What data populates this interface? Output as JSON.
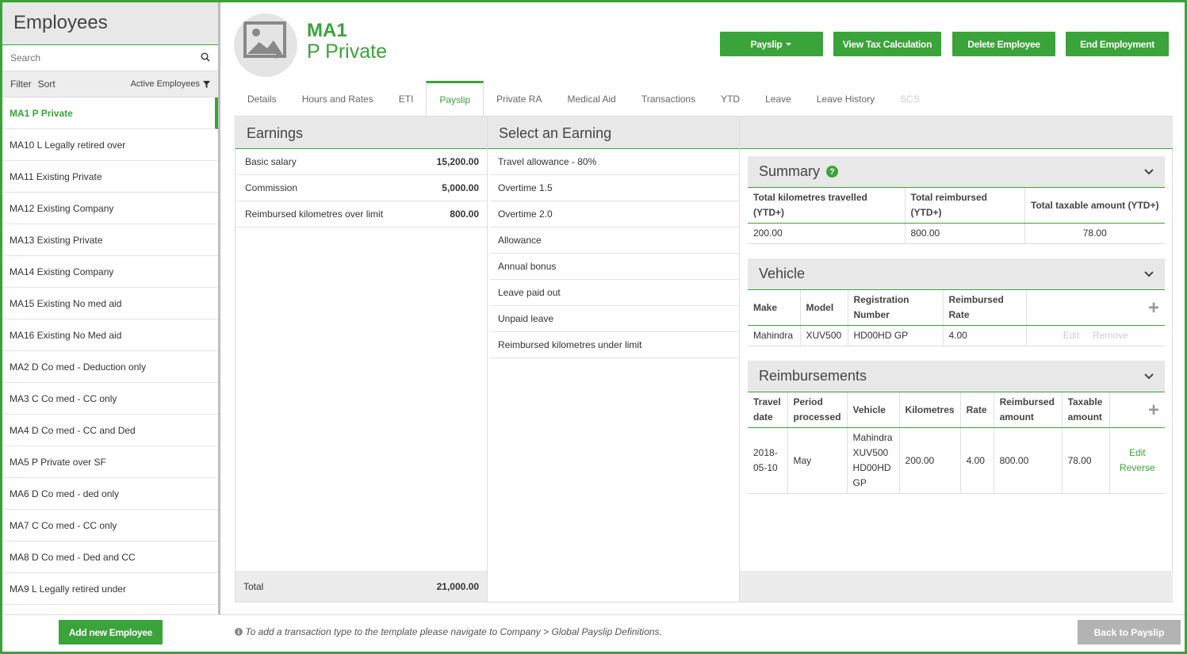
{
  "sidebar": {
    "title": "Employees",
    "search_placeholder": "Search",
    "filter_label": "Filter",
    "sort_label": "Sort",
    "active_filter": "Active Employees",
    "items": [
      {
        "label": "MA1 P Private",
        "selected": true
      },
      {
        "label": "MA10 L Legally retired over"
      },
      {
        "label": "MA11 Existing Private"
      },
      {
        "label": "MA12 Existing Company"
      },
      {
        "label": "MA13 Existing Private"
      },
      {
        "label": "MA14 Existing Company"
      },
      {
        "label": "MA15 Existing No med aid"
      },
      {
        "label": "MA16 Existing No Med aid"
      },
      {
        "label": "MA2 D Co med - Deduction only"
      },
      {
        "label": "MA3 C Co med - CC only"
      },
      {
        "label": "MA4 D Co med - CC and Ded"
      },
      {
        "label": "MA5 P Private over SF"
      },
      {
        "label": "MA6 D Co med - ded only"
      },
      {
        "label": "MA7 C Co med - CC only"
      },
      {
        "label": "MA8 D Co med - Ded and CC"
      },
      {
        "label": "MA9 L Legally retired under"
      }
    ],
    "add_button": "Add new Employee"
  },
  "header": {
    "code": "MA1",
    "name": "P Private",
    "buttons": {
      "payslip": "Payslip",
      "tax": "View Tax Calculation",
      "delete": "Delete Employee",
      "end": "End Employment"
    }
  },
  "tabs": [
    {
      "label": "Details"
    },
    {
      "label": "Hours and Rates"
    },
    {
      "label": "ETI"
    },
    {
      "label": "Payslip",
      "active": true
    },
    {
      "label": "Private RA"
    },
    {
      "label": "Medical Aid"
    },
    {
      "label": "Transactions"
    },
    {
      "label": "YTD"
    },
    {
      "label": "Leave"
    },
    {
      "label": "Leave History"
    },
    {
      "label": "SCS",
      "disabled": true
    }
  ],
  "earnings": {
    "title": "Earnings",
    "rows": [
      {
        "label": "Basic salary",
        "value": "15,200.00"
      },
      {
        "label": "Commission",
        "value": "5,000.00"
      },
      {
        "label": "Reimbursed kilometres over limit",
        "value": "800.00"
      }
    ],
    "total_label": "Total",
    "total_value": "21,000.00"
  },
  "select_earning": {
    "title": "Select an Earning",
    "items": [
      "Travel allowance - 80%",
      "Overtime 1.5",
      "Overtime 2.0",
      "Allowance",
      "Annual bonus",
      "Leave paid out",
      "Unpaid leave",
      "Reimbursed kilometres under limit"
    ]
  },
  "summary": {
    "title": "Summary",
    "headers": [
      "Total kilometres travelled (YTD+)",
      "Total reimbursed (YTD+)",
      "Total taxable amount (YTD+)"
    ],
    "values": [
      "200.00",
      "800.00",
      "78.00"
    ]
  },
  "vehicle": {
    "title": "Vehicle",
    "headers": [
      "Make",
      "Model",
      "Registration Number",
      "Reimbursed Rate"
    ],
    "row": [
      "Mahindra",
      "XUV500",
      "HD00HD GP",
      "4.00"
    ],
    "edit": "Edit",
    "remove": "Remove"
  },
  "reimbursements": {
    "title": "Reimbursements",
    "headers": [
      "Travel date",
      "Period processed",
      "Vehicle",
      "Kilometres",
      "Rate",
      "Reimbursed amount",
      "Taxable amount"
    ],
    "row": [
      "2018-05-10",
      "May",
      "Mahindra XUV500 HD00HD GP",
      "200.00",
      "4.00",
      "800.00",
      "78.00"
    ],
    "edit": "Edit",
    "reverse": "Reverse"
  },
  "footer": {
    "hint": "To add a transaction type to the template please navigate to Company > Global Payslip Definitions.",
    "back": "Back to Payslip"
  },
  "colors": {
    "accent": "#3aa33a",
    "disabled_button": "#b3b3b3"
  }
}
